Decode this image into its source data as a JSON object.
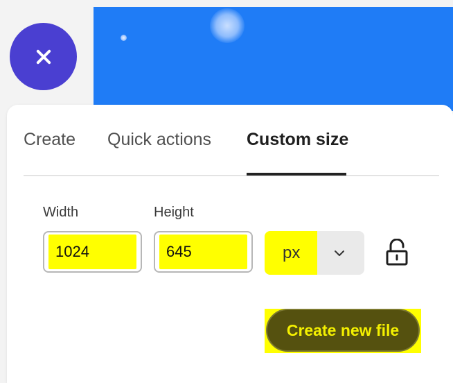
{
  "dialog": {
    "close_icon": "close-icon",
    "accent_color": "#4a3fd1",
    "banner_color": "#1f7cf6",
    "tabs": [
      {
        "label": "Create",
        "active": false
      },
      {
        "label": "Quick actions",
        "active": false
      },
      {
        "label": "Custom size",
        "active": true
      }
    ],
    "size_form": {
      "width_label": "Width",
      "width_value": "1024",
      "height_label": "Height",
      "height_value": "645",
      "unit_value": "px",
      "unit_dropdown_icon": "chevron-down-icon",
      "lock_icon": "unlock-icon"
    },
    "create_button": {
      "label": "Create new file",
      "background_color": "#55510f",
      "text_color": "#f4f000"
    },
    "highlight_color": "#ffff00"
  }
}
